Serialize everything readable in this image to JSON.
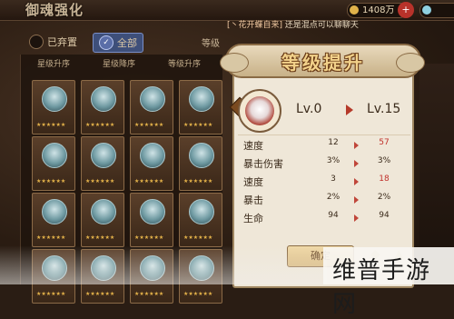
{
  "top": {
    "title": "御魂强化",
    "currency_1": "1408万",
    "currency_2": "",
    "chat": {
      "name": "[丶花开蝶自来]",
      "message": "还是混点可以聊聊天"
    }
  },
  "filter": {
    "owned_label": "已弃置",
    "all_label": "全部",
    "grade_label": "等级"
  },
  "sort_tabs": [
    "星级升序",
    "星级降序",
    "等级升序"
  ],
  "grid": {
    "rows": 4,
    "cols": 4,
    "stars": "★★★★★★"
  },
  "dialog": {
    "title": "等级提升",
    "level_from": "Lv.0",
    "level_to": "Lv.15",
    "stats": [
      {
        "name": "速度",
        "old": "12",
        "new": "57",
        "changed": true
      },
      {
        "name": "暴击伤害",
        "old": "3%",
        "new": "3%",
        "changed": false
      },
      {
        "name": "速度",
        "old": "3",
        "new": "18",
        "changed": true
      },
      {
        "name": "暴击",
        "old": "2%",
        "new": "2%",
        "changed": false
      },
      {
        "name": "生命",
        "old": "94",
        "new": "94",
        "changed": false
      }
    ],
    "confirm_label": "确定"
  },
  "watermark": "维普手游网",
  "colors": {
    "accent_red": "#c0302a",
    "parchment": "#efe7d8",
    "gold": "#e5b34a"
  }
}
